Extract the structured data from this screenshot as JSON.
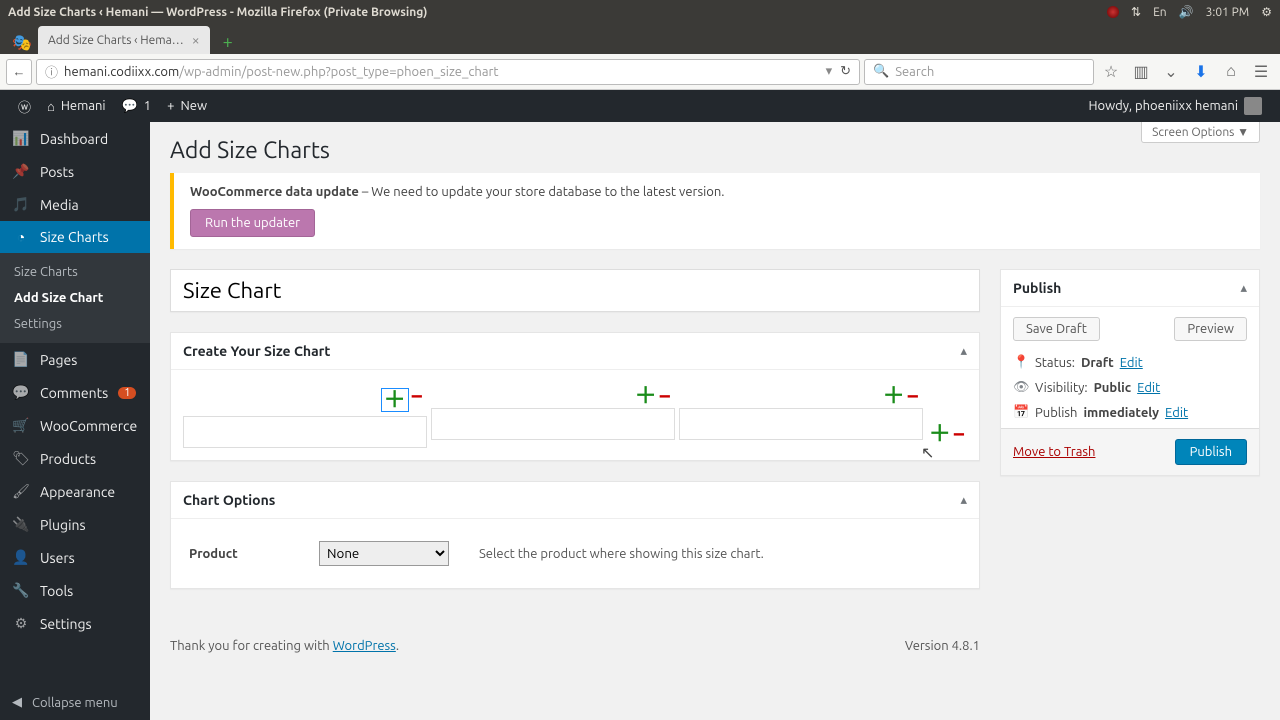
{
  "os": {
    "title": "Add Size Charts ‹ Hemani — WordPress - Mozilla Firefox (Private Browsing)",
    "lang": "En",
    "time": "3:01 PM"
  },
  "browser": {
    "tab_label": "Add Size Charts ‹ Hema…",
    "url_domain": "hemani.codiixx.com",
    "url_path": "/wp-admin/post-new.php?post_type=phoen_size_chart",
    "search_placeholder": "Search"
  },
  "adminbar": {
    "site_name": "Hemani",
    "comments_count": "1",
    "new_label": "New",
    "howdy": "Howdy, phoeniixx hemani"
  },
  "sidebar": {
    "items": [
      {
        "icon": "📊",
        "label": "Dashboard"
      },
      {
        "icon": "📌",
        "label": "Posts"
      },
      {
        "icon": "🎵",
        "label": "Media"
      },
      {
        "icon": "◔",
        "label": "Size Charts"
      },
      {
        "icon": "📄",
        "label": "Pages"
      },
      {
        "icon": "💬",
        "label": "Comments"
      },
      {
        "icon": "🛒",
        "label": "WooCommerce"
      },
      {
        "icon": "🏷",
        "label": "Products"
      },
      {
        "icon": "🖌",
        "label": "Appearance"
      },
      {
        "icon": "🔌",
        "label": "Plugins"
      },
      {
        "icon": "👤",
        "label": "Users"
      },
      {
        "icon": "🔧",
        "label": "Tools"
      },
      {
        "icon": "⚙",
        "label": "Settings"
      }
    ],
    "submenu": [
      "Size Charts",
      "Add Size Chart",
      "Settings"
    ],
    "comments_badge": "1",
    "collapse": "Collapse menu"
  },
  "page": {
    "screen_options": "Screen Options",
    "title": "Add Size Charts",
    "notice_bold": "WooCommerce data update",
    "notice_text": " – We need to update your store database to the latest version.",
    "notice_btn": "Run the updater",
    "title_input": "Size Chart",
    "box1_title": "Create Your Size Chart",
    "box2_title": "Chart Options",
    "product_label": "Product",
    "product_value": "None",
    "product_hint": "Select the product where showing this size chart.",
    "footer_text": "Thank you for creating with ",
    "footer_link": "WordPress",
    "version": "Version 4.8.1"
  },
  "publish": {
    "heading": "Publish",
    "save_draft": "Save Draft",
    "preview": "Preview",
    "status_label": "Status:",
    "status_value": "Draft",
    "visibility_label": "Visibility:",
    "visibility_value": "Public",
    "publish_label": "Publish",
    "publish_value": "immediately",
    "edit": "Edit",
    "trash": "Move to Trash",
    "publish_btn": "Publish"
  }
}
